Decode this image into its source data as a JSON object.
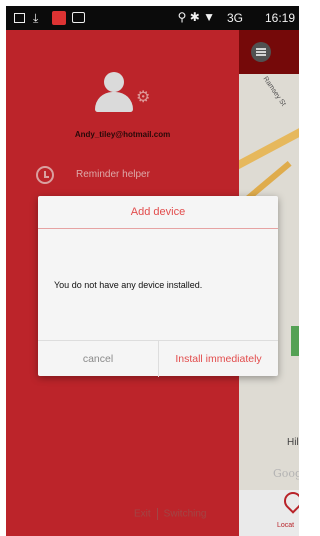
{
  "status_bar": {
    "time": "16:19",
    "network": "3G",
    "icons": [
      "notification-icon",
      "download-icon",
      "app-notification-icon",
      "photo-icon",
      "location-icon",
      "bluetooth-icon",
      "wifi-icon",
      "signal-icon",
      "battery-icon"
    ]
  },
  "drawer": {
    "email": "Andy_tiley@hotmail.com",
    "menu": [
      {
        "label": "Reminder helper",
        "icon": "clock-icon"
      }
    ],
    "footer": {
      "exit": "Exit",
      "switching": "Switching"
    },
    "color": "#c4262c"
  },
  "map": {
    "street": "Ramsey St",
    "place": "HillyF",
    "watermark": "Google",
    "tab_label": "Locat"
  },
  "dialog": {
    "title": "Add device",
    "message": "You do not have any device installed.",
    "cancel_label": "cancel",
    "confirm_label": "Install immediately",
    "accent_color": "#e24c4c"
  }
}
